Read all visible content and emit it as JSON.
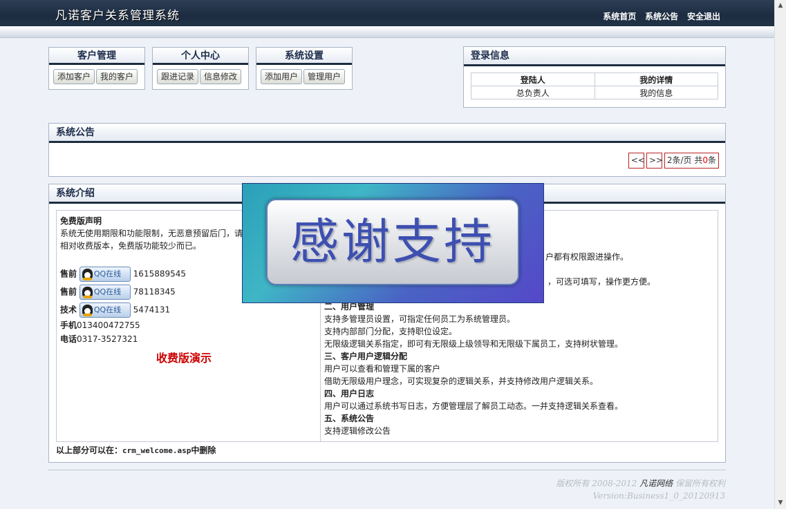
{
  "header": {
    "title": "凡诺客户关系管理系统",
    "nav": [
      "系统首页",
      "系统公告",
      "安全退出"
    ]
  },
  "menus": [
    {
      "title": "客户管理",
      "buttons": [
        "添加客户",
        "我的客户"
      ]
    },
    {
      "title": "个人中心",
      "buttons": [
        "跟进记录",
        "信息修改"
      ]
    },
    {
      "title": "系统设置",
      "buttons": [
        "添加用户",
        "管理用户"
      ]
    }
  ],
  "login": {
    "title": "登录信息",
    "headers": [
      "登陆人",
      "我的详情"
    ],
    "row": [
      "总负责人",
      "我的信息"
    ]
  },
  "notice": {
    "title": "系统公告",
    "prev": "<<",
    "next": ">>",
    "per_page": "2条/页 共",
    "total": "0",
    "unit": "条"
  },
  "intro": {
    "title": "系统介绍",
    "disclaimer_title": "免费版声明",
    "disclaimer_lines": [
      "系统无使用期限和功能限制，无恶意预留后门，请",
      "相对收费版本，免费版功能较少而已。"
    ],
    "contacts": [
      {
        "label": "售前",
        "button": "QQ在线",
        "number": "1615889545"
      },
      {
        "label": "售前",
        "button": "QQ在线",
        "number": "78118345"
      },
      {
        "label": "技术",
        "button": "QQ在线",
        "number": "5474131"
      }
    ],
    "phone_label": "手机",
    "phone": "013400472755",
    "tel_label": "电话",
    "tel": "0317-3527321",
    "demo_link": "收费版演示",
    "right_lines": [
      {
        "text": "户都有权限跟进操作。",
        "bold": false
      },
      {
        "text": "，可选可填写，操作更方便。",
        "bold": false
      },
      {
        "text": "二、用户管理",
        "bold": true
      },
      {
        "text": "支持多管理员设置，可指定任何员工为系统管理员。",
        "bold": false
      },
      {
        "text": "支持内部部门分配，支持职位设定。",
        "bold": false
      },
      {
        "text": "无限级逻辑关系指定，即可有无限级上级领导和无限级下属员工，支持树状管理。",
        "bold": false
      },
      {
        "text": "三、客户用户逻辑分配",
        "bold": true
      },
      {
        "text": "用户可以查看和管理下属的客户",
        "bold": false
      },
      {
        "text": "借助无限级用户理念，可实现复杂的逻辑关系，并支持修改用户逻辑关系。",
        "bold": false
      },
      {
        "text": "四、用户日志",
        "bold": true
      },
      {
        "text": "用户可以通过系统书写日志，方便管理层了解员工动态。一并支持逻辑关系查看。",
        "bold": false
      },
      {
        "text": "五、系统公告",
        "bold": true
      },
      {
        "text": "支持逻辑修改公告",
        "bold": false
      }
    ],
    "footnote_prefix": "以上部分可以在：",
    "footnote_file": "crm_welcome.asp",
    "footnote_suffix": "中删除"
  },
  "overlay": {
    "text": "感谢支持"
  },
  "footer": {
    "copyright_prefix": "版权所有 2008-2012",
    "brand": "凡诺网络",
    "copyright_suffix": "保留所有权利",
    "version": "Version:Business1_0_20120913"
  },
  "colors": {
    "header_bg": "#1d2c40",
    "panel_border": "#a7b4c4",
    "demo_red": "#cc0000",
    "overlay_text": "#3d4fb0"
  }
}
